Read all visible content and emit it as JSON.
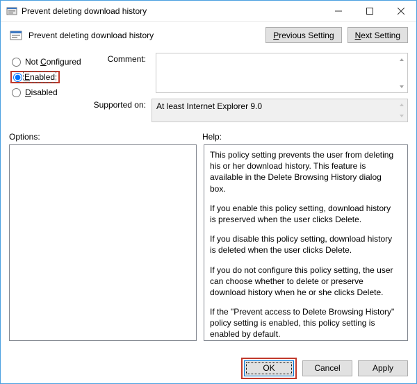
{
  "window": {
    "title": "Prevent deleting download history"
  },
  "header": {
    "title": "Prevent deleting download history",
    "prev_label": "Previous Setting",
    "next_label": "Next Setting"
  },
  "radios": {
    "not_configured": "Not Configured",
    "enabled": "Enabled",
    "disabled": "Disabled",
    "selected": "enabled"
  },
  "labels": {
    "comment": "Comment:",
    "supported": "Supported on:",
    "options": "Options:",
    "help": "Help:"
  },
  "supported_value": "At least Internet Explorer 9.0",
  "help_paragraphs": [
    "This policy setting prevents the user from deleting his or her download history. This feature is available in the Delete Browsing History dialog box.",
    "If you enable this policy setting, download history is preserved when the user clicks Delete.",
    "If you disable this policy setting, download history is deleted when the user clicks Delete.",
    "If you do not configure this policy setting, the user can choose whether to delete or preserve download history when he or she clicks Delete.",
    "If the \"Prevent access to Delete Browsing History\" policy setting is enabled, this policy setting is enabled by default."
  ],
  "footer": {
    "ok": "OK",
    "cancel": "Cancel",
    "apply": "Apply"
  }
}
